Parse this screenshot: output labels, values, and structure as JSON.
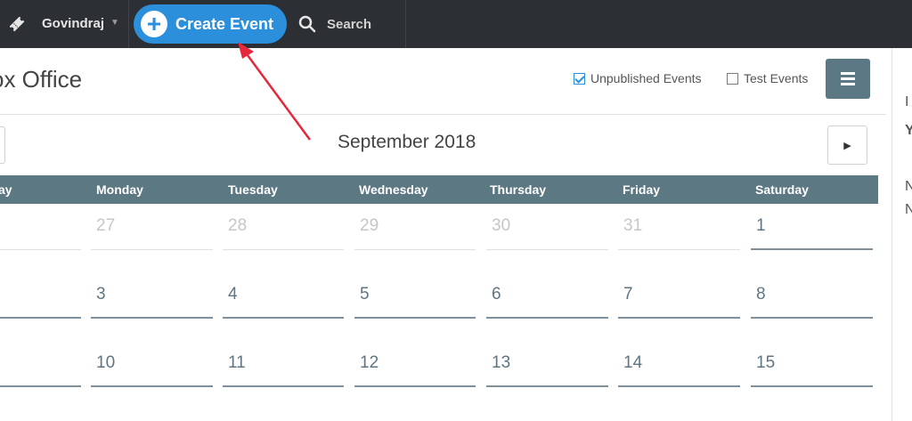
{
  "topbar": {
    "user_name": "Govindraj",
    "create_label": "Create Event",
    "search_label": "Search"
  },
  "page": {
    "title": "ox Office"
  },
  "filters": {
    "unpublished": {
      "label": "Unpublished Events",
      "checked": true
    },
    "test": {
      "label": "Test Events",
      "checked": false
    }
  },
  "calendar": {
    "month_title": "September 2018",
    "weekdays": [
      "ay",
      "Monday",
      "Tuesday",
      "Wednesday",
      "Thursday",
      "Friday",
      "Saturday"
    ],
    "week1": [
      "",
      "27",
      "28",
      "29",
      "30",
      "31",
      "1"
    ],
    "week2": [
      "",
      "3",
      "4",
      "5",
      "6",
      "7",
      "8"
    ],
    "week3": [
      "",
      "10",
      "11",
      "12",
      "13",
      "14",
      "15"
    ]
  },
  "sidebar": {
    "line1": "I",
    "line2": "Y",
    "line3": "N",
    "line4": "N"
  },
  "colors": {
    "topbar": "#2c2f33",
    "accent": "#2c8fdc",
    "header_row": "#5c7883",
    "annotation": "#e5283a"
  }
}
